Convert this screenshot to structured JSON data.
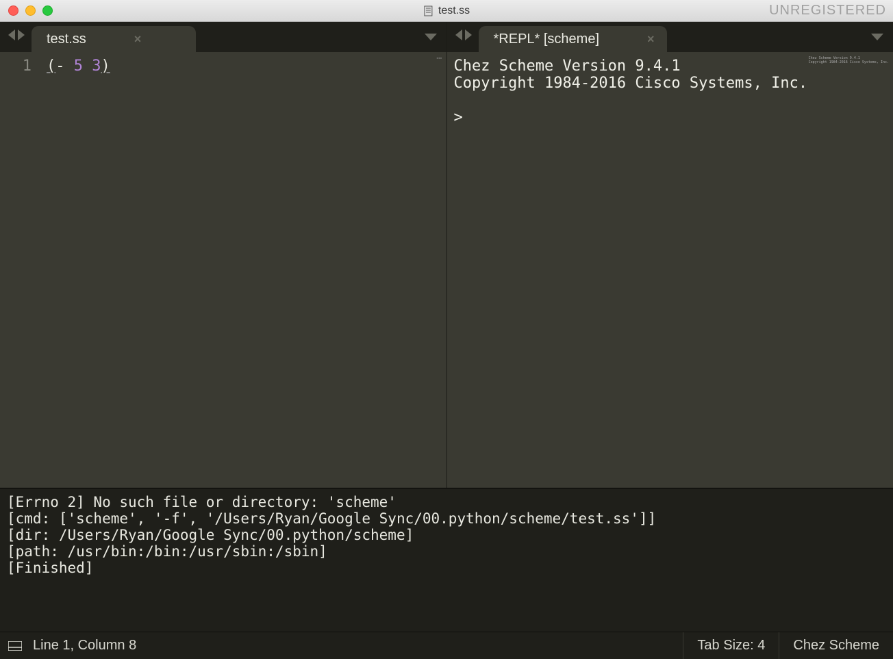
{
  "window": {
    "title": "test.ss",
    "unregistered": "UNREGISTERED"
  },
  "panes": {
    "left": {
      "tab_label": "test.ss",
      "line_number": "1",
      "code_paren_open": "(",
      "code_op": "-",
      "code_num1": "5",
      "code_num2": "3",
      "code_paren_close": ")"
    },
    "right": {
      "tab_label": "*REPL* [scheme]",
      "line1": "Chez Scheme Version 9.4.1",
      "line2": "Copyright 1984-2016 Cisco Systems, Inc.",
      "blank": "",
      "prompt": "> "
    }
  },
  "build": {
    "l1": "[Errno 2] No such file or directory: 'scheme'",
    "l2": "[cmd: ['scheme', '-f', '/Users/Ryan/Google Sync/00.python/scheme/test.ss']]",
    "l3": "[dir: /Users/Ryan/Google Sync/00.python/scheme]",
    "l4": "[path: /usr/bin:/bin:/usr/sbin:/sbin]",
    "l5": "[Finished]"
  },
  "status": {
    "position": "Line 1, Column 8",
    "tab_size": "Tab Size: 4",
    "syntax": "Chez Scheme"
  }
}
